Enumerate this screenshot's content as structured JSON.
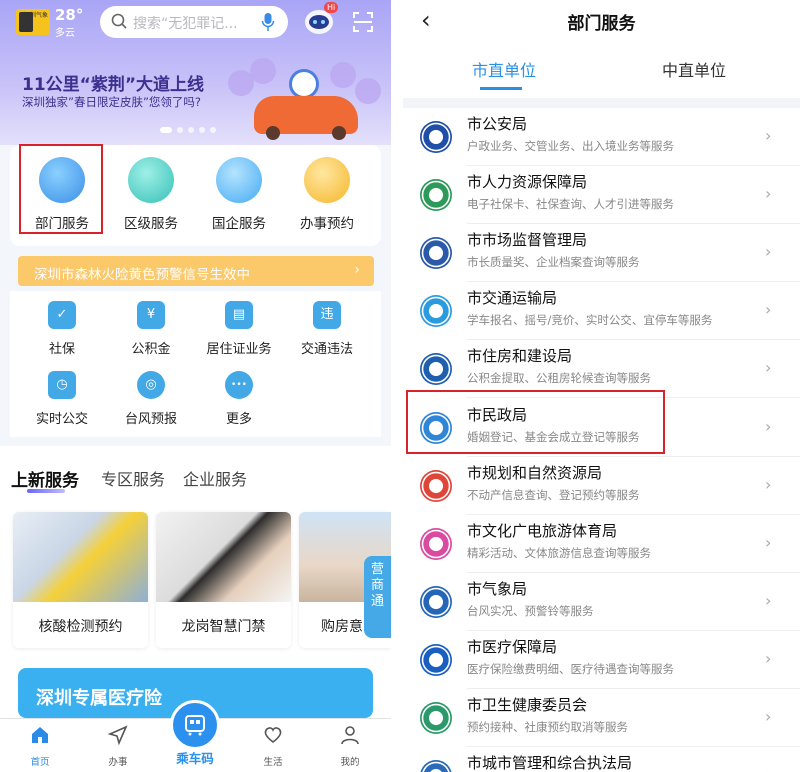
{
  "left": {
    "weather": {
      "logo_text": "深圳气象",
      "temperature": "28°",
      "condition": "多云"
    },
    "search": {
      "placeholder": "搜索“无犯罪记..."
    },
    "assistant": {
      "badge": "Hi"
    },
    "banner": {
      "title": "11公里“紫荆”大道上线",
      "subtitle": "深圳独家”春日限定皮肤”您领了吗?"
    },
    "main_services": [
      {
        "label": "部门服务",
        "icon": "department-service-icon",
        "color": "#3b8fe6"
      },
      {
        "label": "区级服务",
        "icon": "district-service-icon",
        "color": "#36c0b8"
      },
      {
        "label": "国企服务",
        "icon": "soe-service-icon",
        "color": "#45aaf2"
      },
      {
        "label": "办事预约",
        "icon": "appointment-icon",
        "color": "#f5b62b"
      }
    ],
    "alert": {
      "text": "深圳市森林火险黄色预警信号生效中"
    },
    "quick_services": [
      {
        "label": "社保",
        "icon": "shield-check-icon",
        "glyph": "✓"
      },
      {
        "label": "公积金",
        "icon": "house-yen-icon",
        "glyph": "¥"
      },
      {
        "label": "居住证业务",
        "icon": "id-card-icon",
        "glyph": "▤"
      },
      {
        "label": "交通违法",
        "icon": "traffic-violation-icon",
        "glyph": "违"
      },
      {
        "label": "实时公交",
        "icon": "bus-clock-icon",
        "glyph": "◷"
      },
      {
        "label": "台风预报",
        "icon": "typhoon-icon",
        "glyph": "◎"
      },
      {
        "label": "更多",
        "icon": "more-dots-icon",
        "glyph": "•••"
      }
    ],
    "section_tabs": [
      {
        "label": "上新服务",
        "active": true
      },
      {
        "label": "专区服务",
        "active": false
      },
      {
        "label": "企业服务",
        "active": false
      }
    ],
    "promos": [
      {
        "label": "核酸检测预约"
      },
      {
        "label": "龙岗智慧门禁"
      },
      {
        "label": "购房意"
      }
    ],
    "side_tab": {
      "label": "营商通"
    },
    "med_banner": {
      "text": "深圳专属医疗险"
    },
    "bottom_nav": [
      {
        "label": "首页",
        "icon": "home-icon",
        "active": true
      },
      {
        "label": "办事",
        "icon": "send-arrow-icon",
        "active": false
      },
      {
        "label": "乘车码",
        "icon": "bus-qr-icon",
        "active": false
      },
      {
        "label": "生活",
        "icon": "heart-icon",
        "active": false
      },
      {
        "label": "我的",
        "icon": "user-icon",
        "active": false
      }
    ]
  },
  "right": {
    "title": "部门服务",
    "tabs": [
      {
        "label": "市直单位",
        "active": true
      },
      {
        "label": "中直单位",
        "active": false
      }
    ],
    "departments": [
      {
        "name": "市公安局",
        "desc": "户政业务、交管业务、出入境业务等服务",
        "icon": "police-badge-icon",
        "color": "#1f4fa8"
      },
      {
        "name": "市人力资源保障局",
        "desc": "电子社保卡、社保查询、人才引进等服务",
        "icon": "hr-emblem-icon",
        "color": "#2d9a5a"
      },
      {
        "name": "市市场监督管理局",
        "desc": "市长质量奖、企业档案查询等服务",
        "icon": "market-supervision-icon",
        "color": "#2a5aa8"
      },
      {
        "name": "市交通运输局",
        "desc": "学车报名、摇号/竞价、实时公交、宜停车等服务",
        "icon": "transport-icon",
        "color": "#2b9be0"
      },
      {
        "name": "市住房和建设局",
        "desc": "公积金提取、公租房轮候查询等服务",
        "icon": "szhc-logo-icon",
        "color": "#1f5fb0"
      },
      {
        "name": "市民政局",
        "desc": "婚姻登记、基金会成立登记等服务",
        "icon": "civil-affairs-icon",
        "color": "#2f86d6"
      },
      {
        "name": "市规划和自然资源局",
        "desc": "不动产信息查询、登记预约等服务",
        "icon": "planning-icon",
        "color": "#e0453a"
      },
      {
        "name": "市文化广电旅游体育局",
        "desc": "精彩活动、文体旅游信息查询等服务",
        "icon": "culture-tourism-icon",
        "color": "#d94aa0"
      },
      {
        "name": "市气象局",
        "desc": "台风实况、预警铃等服务",
        "icon": "weather-bureau-icon",
        "color": "#2566b8"
      },
      {
        "name": "市医疗保障局",
        "desc": "医疗保险缴费明细、医疗待遇查询等服务",
        "icon": "medical-security-icon",
        "color": "#1a5fc0"
      },
      {
        "name": "市卫生健康委员会",
        "desc": "预约接种、社康预约取消等服务",
        "icon": "health-commission-icon",
        "color": "#2a9a6a"
      },
      {
        "name": "市城市管理和综合执法局",
        "desc": "",
        "icon": "urban-management-icon",
        "color": "#2a6ab8"
      }
    ]
  }
}
